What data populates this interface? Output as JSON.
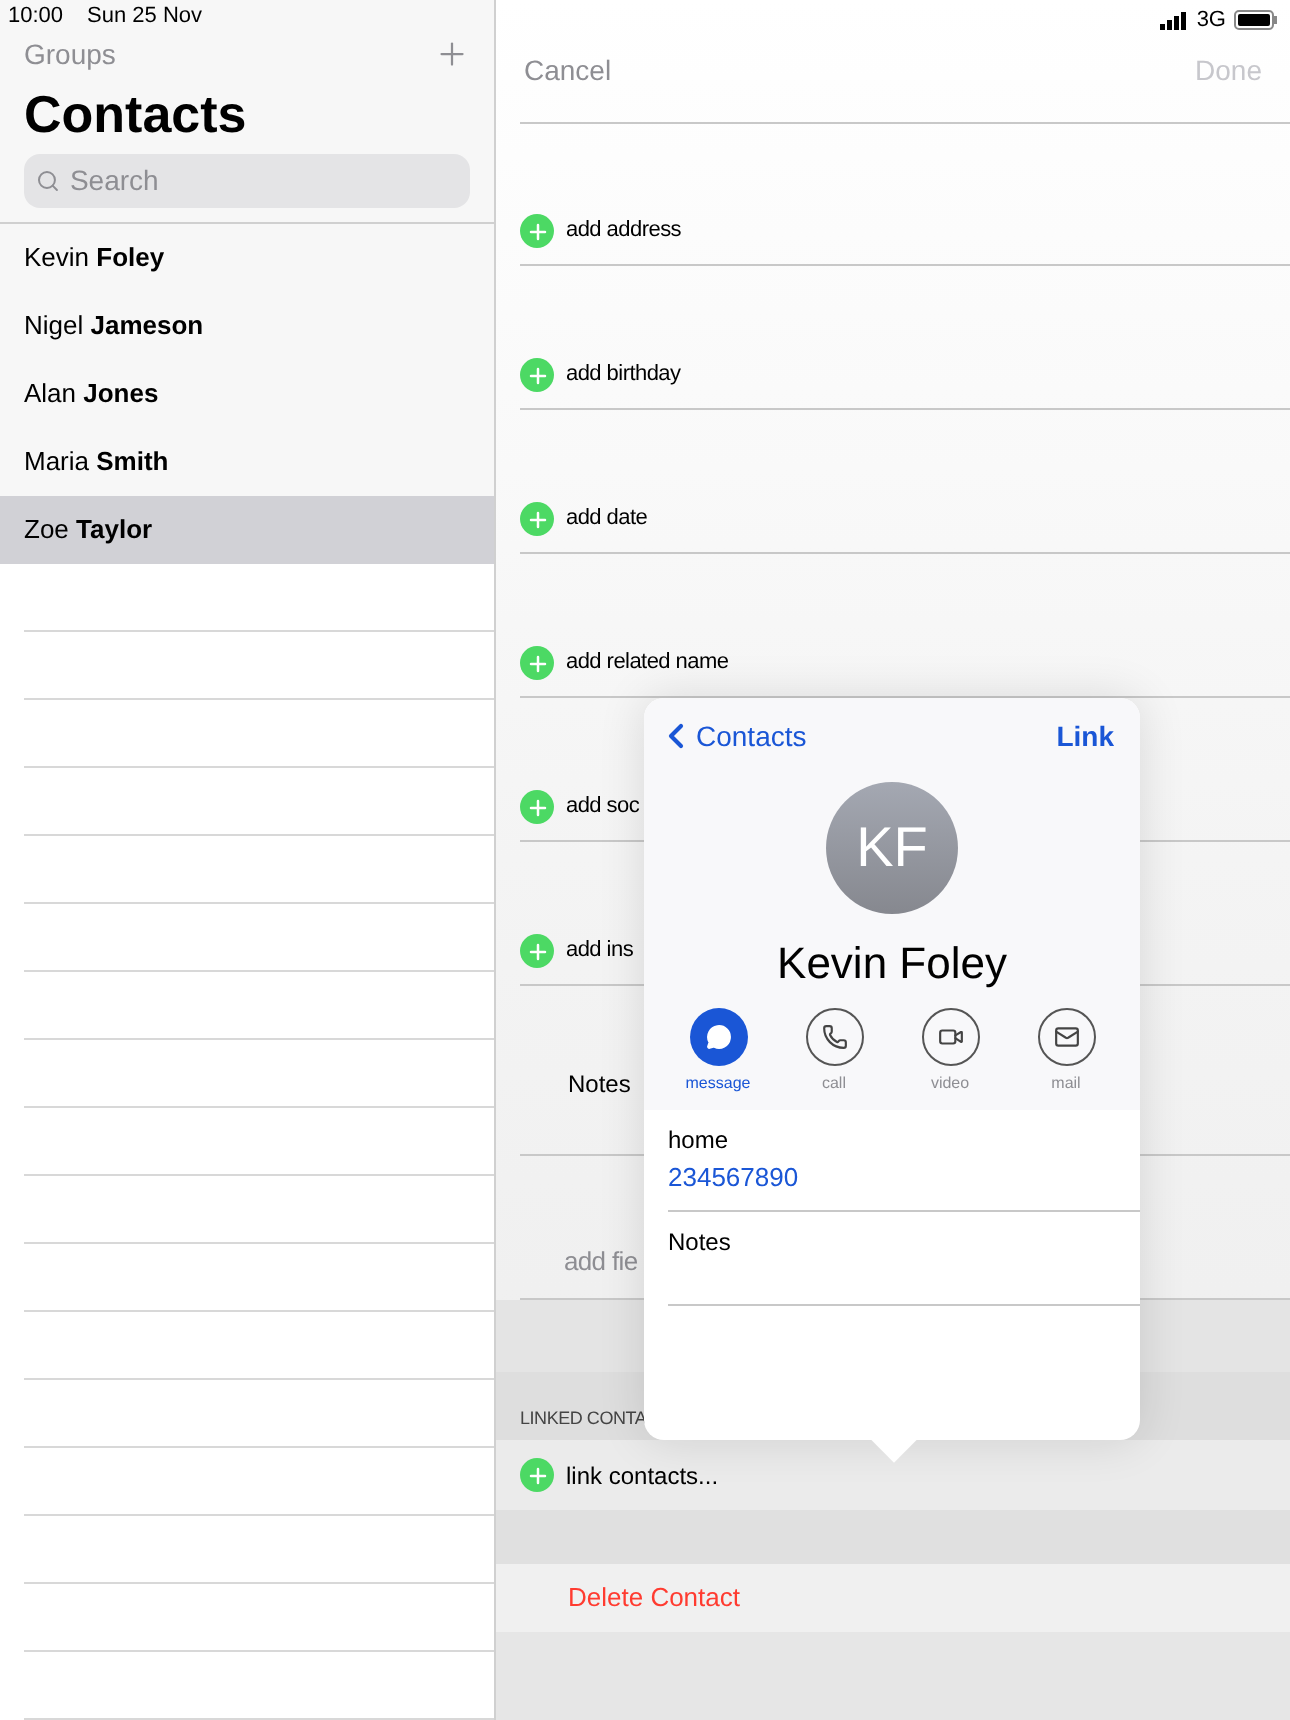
{
  "status_bar": {
    "time": "10:00",
    "date": "Sun 25 Nov",
    "network": "3G"
  },
  "sidebar": {
    "groups_button": "Groups",
    "title": "Contacts",
    "search": {
      "placeholder": "Search"
    },
    "contacts": [
      {
        "name": "Kevin **Foley**",
        "selected": false
      },
      {
        "name": "Nigel **Jameson**",
        "selected": false
      },
      {
        "name": "Alan **Jones**",
        "selected": false
      },
      {
        "name": "Maria **Smith**",
        "selected": false
      },
      {
        "name": "Zoe **Taylor**",
        "selected": true
      }
    ]
  },
  "editor": {
    "cancel": "Cancel",
    "done": "Done",
    "done_disabled": true,
    "fields": [
      {
        "kind": "add",
        "label": "add address"
      },
      {
        "kind": "add",
        "label": "add birthday"
      },
      {
        "kind": "add",
        "label": "add date"
      },
      {
        "kind": "add",
        "label": "add related name"
      },
      {
        "kind": "add",
        "label": "add soc"
      },
      {
        "kind": "add",
        "label": "add ins"
      },
      {
        "kind": "notes",
        "label": "Notes"
      },
      {
        "kind": "placeholder",
        "label": "add fie"
      }
    ],
    "linked_header": "LINKED CONTA",
    "link_contacts": "link contacts...",
    "delete": "Delete Contact"
  },
  "popover": {
    "back": "Contacts",
    "link": "Link",
    "initials": "KF",
    "name": "Kevin Foley",
    "actions": [
      {
        "kind": "message",
        "label": "message",
        "selected": true
      },
      {
        "kind": "call",
        "label": "call",
        "selected": false
      },
      {
        "kind": "video",
        "label": "video",
        "selected": false
      },
      {
        "kind": "mail",
        "label": "mail",
        "selected": false
      }
    ],
    "phone": {
      "label": "home",
      "value": "234567890"
    },
    "notes_label": "Notes"
  }
}
